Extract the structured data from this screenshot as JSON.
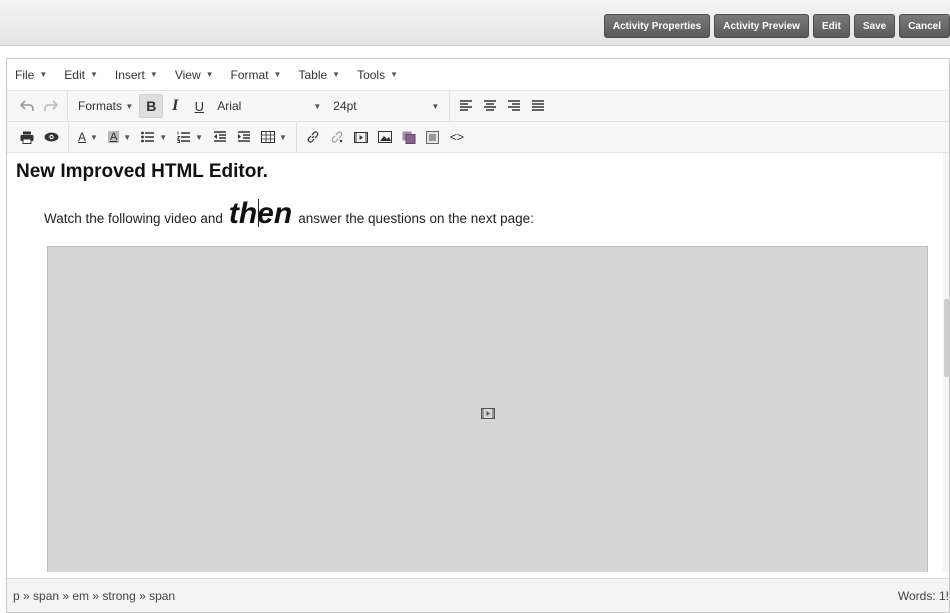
{
  "topbar": {
    "buttons": [
      "Activity Properties",
      "Activity Preview",
      "Edit",
      "Save",
      "Cancel"
    ]
  },
  "menubar": {
    "items": [
      "File",
      "Edit",
      "Insert",
      "View",
      "Format",
      "Table",
      "Tools"
    ]
  },
  "toolbar": {
    "formats_label": "Formats",
    "bold": "B",
    "italic": "I",
    "underline": "U",
    "font_family": "Arial",
    "font_size": "24pt"
  },
  "content": {
    "heading": "New Improved HTML Editor.",
    "para_before": "Watch the following video and",
    "para_emph": "then",
    "para_after": "answer the questions on the next page:"
  },
  "statusbar": {
    "path": "p » span » em » strong » span",
    "wordcount": "Words: 1!"
  },
  "icons": {
    "undo": "undo-icon",
    "redo": "redo-icon",
    "print": "print-icon",
    "preview": "eye-icon",
    "font_color": "text-color-icon",
    "bg_color": "background-color-icon",
    "bullist": "bullet-list-icon",
    "numlist": "numbered-list-icon",
    "outdent": "outdent-icon",
    "indent": "indent-icon",
    "table": "table-icon",
    "link": "link-icon",
    "unlink": "unlink-icon",
    "media": "media-icon",
    "image": "image-icon",
    "video_placeholder": "video-placeholder-icon"
  }
}
